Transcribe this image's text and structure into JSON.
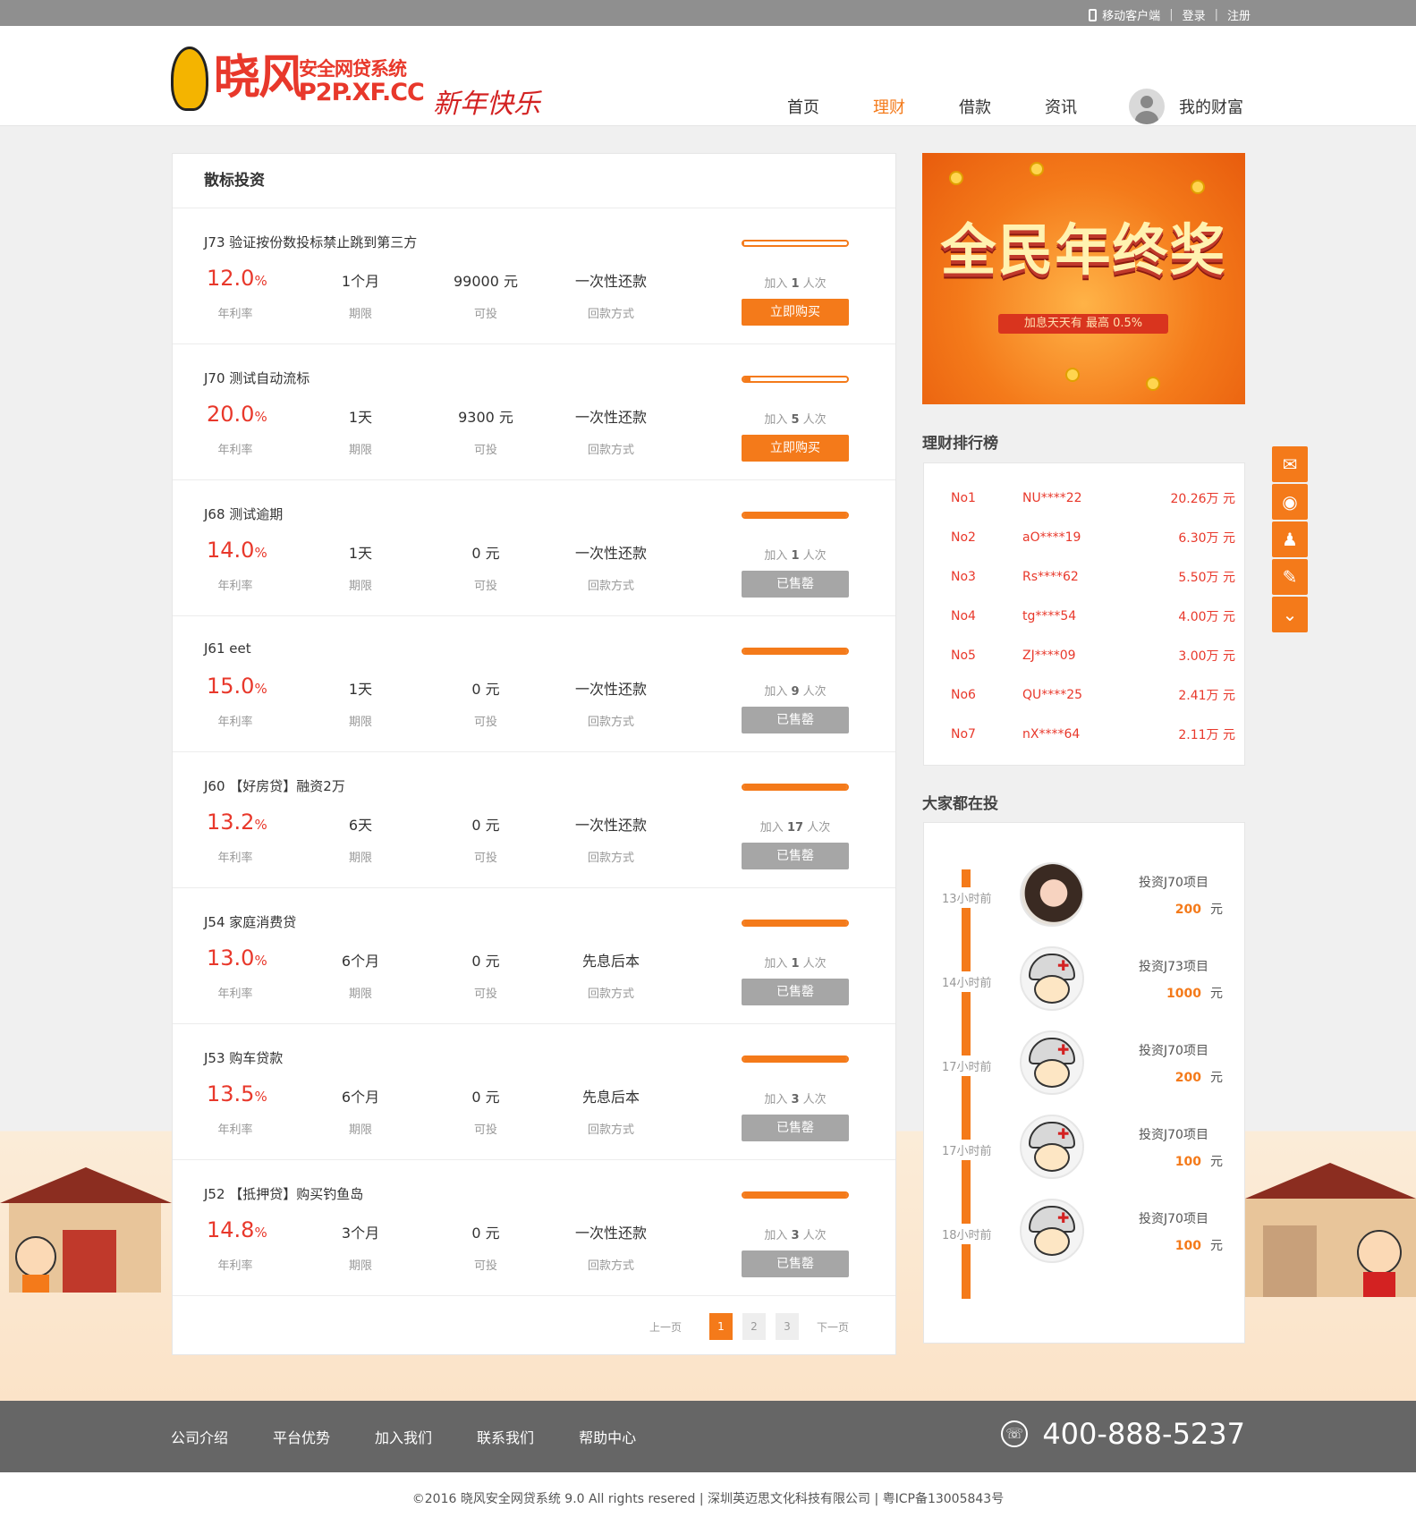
{
  "topbar": {
    "mobile": "移动客户端",
    "login": "登录",
    "register": "注册"
  },
  "header": {
    "logo_big": "晓风",
    "logo_line1": "安全网贷系统",
    "logo_line2": "P2P.XF.CC",
    "new_year": "新年快乐",
    "nav": [
      "首页",
      "理财",
      "借款",
      "资讯"
    ],
    "nav_active": "理财",
    "my_wealth": "我的财富"
  },
  "main": {
    "title": "散标投资",
    "labels": {
      "rate": "年利率",
      "term": "期限",
      "available": "可投",
      "repay": "回款方式",
      "join_prefix": "加入",
      "join_suffix": "人次"
    },
    "loans": [
      {
        "name": "J73  验证按份数投标禁止跳到第三方",
        "rate": "12.0",
        "term": "1个月",
        "available": "99000 元",
        "repay": "一次性还款",
        "joined": "1",
        "progress": 0.01,
        "button": "立即购买",
        "sold": false
      },
      {
        "name": "J70  测试自动流标",
        "rate": "20.0",
        "term": "1天",
        "available": "9300 元",
        "repay": "一次性还款",
        "joined": "5",
        "progress": 0.07,
        "button": "立即购买",
        "sold": false
      },
      {
        "name": "J68  测试逾期",
        "rate": "14.0",
        "term": "1天",
        "available": "0 元",
        "repay": "一次性还款",
        "joined": "1",
        "progress": 1,
        "button": "已售罄",
        "sold": true
      },
      {
        "name": "J61  eet",
        "rate": "15.0",
        "term": "1天",
        "available": "0 元",
        "repay": "一次性还款",
        "joined": "9",
        "progress": 1,
        "button": "已售罄",
        "sold": true
      },
      {
        "name": "J60  【好房贷】融资2万",
        "rate": "13.2",
        "term": "6天",
        "available": "0 元",
        "repay": "一次性还款",
        "joined": "17",
        "progress": 1,
        "button": "已售罄",
        "sold": true
      },
      {
        "name": "J54  家庭消费贷",
        "rate": "13.0",
        "term": "6个月",
        "available": "0 元",
        "repay": "先息后本",
        "joined": "1",
        "progress": 1,
        "button": "已售罄",
        "sold": true
      },
      {
        "name": "J53  购车贷款",
        "rate": "13.5",
        "term": "6个月",
        "available": "0 元",
        "repay": "先息后本",
        "joined": "3",
        "progress": 1,
        "button": "已售罄",
        "sold": true
      },
      {
        "name": "J52  【抵押贷】购买钓鱼岛",
        "rate": "14.8",
        "term": "3个月",
        "available": "0 元",
        "repay": "一次性还款",
        "joined": "3",
        "progress": 1,
        "button": "已售罄",
        "sold": true
      }
    ],
    "pager": {
      "prev": "上一页",
      "pages": [
        "1",
        "2",
        "3"
      ],
      "current": "1",
      "next": "下一页"
    }
  },
  "banner": {
    "title": "全民年终奖",
    "subtitle": "加息天天有 最高 0.5%"
  },
  "ranking": {
    "title": "理财排行榜",
    "rows": [
      {
        "no": "No1",
        "user": "NU****22",
        "amount": "20.26万 元"
      },
      {
        "no": "No2",
        "user": "aO****19",
        "amount": "6.30万 元"
      },
      {
        "no": "No3",
        "user": "Rs****62",
        "amount": "5.50万 元"
      },
      {
        "no": "No4",
        "user": "tg****54",
        "amount": "4.00万 元"
      },
      {
        "no": "No5",
        "user": "ZJ****09",
        "amount": "3.00万 元"
      },
      {
        "no": "No6",
        "user": "QU****25",
        "amount": "2.41万 元"
      },
      {
        "no": "No7",
        "user": "nX****64",
        "amount": "2.11万 元"
      }
    ]
  },
  "investing": {
    "title": "大家都在投",
    "unit": "元",
    "rows": [
      {
        "ago": "13小时前",
        "what": "投资J70项目",
        "amount": "200",
        "avatar": "girl"
      },
      {
        "ago": "14小时前",
        "what": "投资J73项目",
        "amount": "1000",
        "avatar": "soldier"
      },
      {
        "ago": "17小时前",
        "what": "投资J70项目",
        "amount": "200",
        "avatar": "soldier"
      },
      {
        "ago": "17小时前",
        "what": "投资J70项目",
        "amount": "100",
        "avatar": "soldier"
      },
      {
        "ago": "18小时前",
        "what": "投资J70项目",
        "amount": "100",
        "avatar": "soldier"
      }
    ]
  },
  "side_tools": [
    "wechat-icon",
    "weibo-icon",
    "qq-icon",
    "edit-icon",
    "chevron-down-icon"
  ],
  "footer": {
    "links": [
      "公司介绍",
      "平台优势",
      "加入我们",
      "联系我们",
      "帮助中心"
    ],
    "phone": "400-888-5237",
    "copyright": "©2016 晓风安全网贷系统 9.0  All rights resered   |   深圳英迈思文化科技有限公司   |   粤ICP备13005843号"
  },
  "colors": {
    "accent": "#f47a1a",
    "rate": "#e8382b",
    "sold": "#a6a6a6"
  }
}
